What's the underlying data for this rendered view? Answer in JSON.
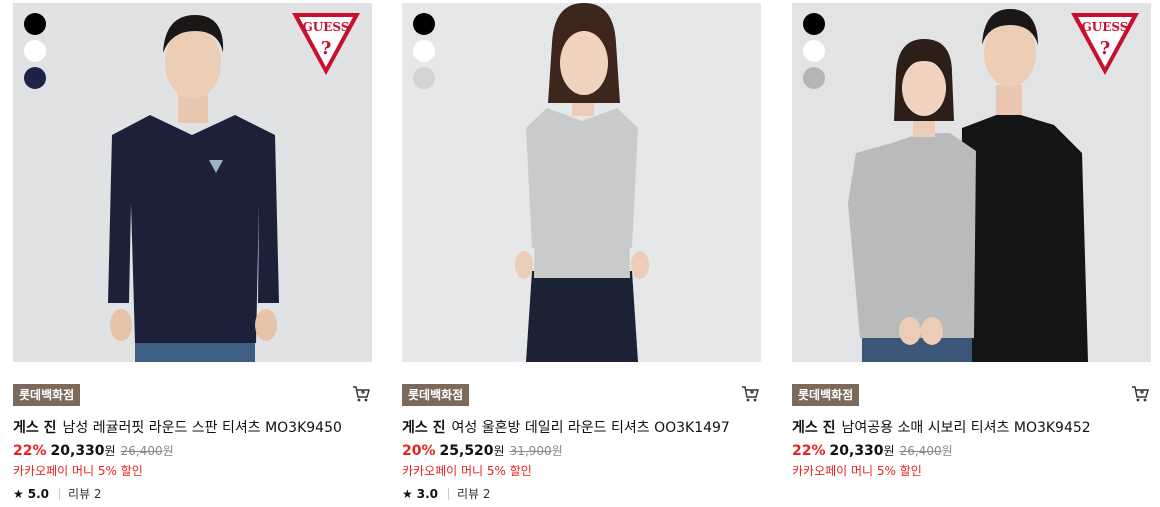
{
  "products": [
    {
      "swatches": [
        "#000000",
        "#ffffff",
        "#1d2347"
      ],
      "logo": "GUESS",
      "store": "롯데백화점",
      "brand": "게스 진",
      "name": "남성 레귤러핏 라운드 스판 티셔츠 MO3K9450",
      "discount": "22%",
      "price": "20,330",
      "won": "원",
      "original": "26,400",
      "original_won": "원",
      "promo": "카카오페이 머니 5% 할인",
      "rating": "5.0",
      "reviews": "리뷰 2"
    },
    {
      "swatches": [
        "#000000",
        "#ffffff",
        "#d3d3d3"
      ],
      "store": "롯데백화점",
      "brand": "게스 진",
      "name": "여성 울혼방 데일리 라운드 티셔츠 OO3K1497",
      "discount": "20%",
      "price": "25,520",
      "won": "원",
      "original": "31,900",
      "original_won": "원",
      "promo": "카카오페이 머니 5% 할인",
      "rating": "3.0",
      "reviews": "리뷰 2"
    },
    {
      "swatches": [
        "#000000",
        "#ffffff",
        "#b5b5b5"
      ],
      "logo": "GUESS",
      "store": "롯데백화점",
      "brand": "게스 진",
      "name": "남여공용 소매 시보리 티셔츠 MO3K9452",
      "discount": "22%",
      "price": "20,330",
      "won": "원",
      "original": "26,400",
      "original_won": "원",
      "promo": "카카오페이 머니 5% 할인"
    }
  ],
  "icons": {
    "cart": "cart-icon",
    "star": "star-icon",
    "logo": "guess-triangle-logo"
  },
  "colors": {
    "discount": "#e8231f",
    "store_badge": "#7b6a5b"
  }
}
